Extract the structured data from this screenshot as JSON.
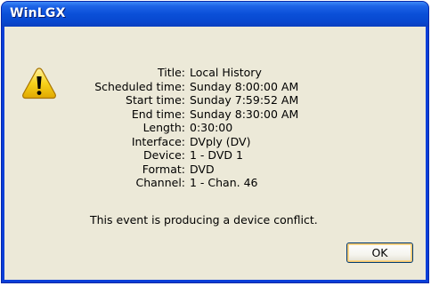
{
  "window": {
    "title": "WinLGX"
  },
  "details": [
    {
      "label": "Title:",
      "value": "Local History"
    },
    {
      "label": "Scheduled time:",
      "value": "Sunday 8:00:00 AM"
    },
    {
      "label": "Start time:",
      "value": "Sunday 7:59:52 AM"
    },
    {
      "label": "End time:",
      "value": "Sunday 8:30:00 AM"
    },
    {
      "label": "Length:",
      "value": "0:30:00"
    },
    {
      "label": "Interface:",
      "value": "DVply (DV)"
    },
    {
      "label": "Device:",
      "value": "1 - DVD 1"
    },
    {
      "label": "Format:",
      "value": "DVD"
    },
    {
      "label": "Channel:",
      "value": "1 - Chan. 46"
    }
  ],
  "message": "This event is producing a device conflict.",
  "buttons": {
    "ok_label": "OK"
  },
  "icon": "warning-icon",
  "colors": {
    "titlebar": "#0a4fd8",
    "client": "#ece9d8",
    "warning": "#f7d21b"
  }
}
